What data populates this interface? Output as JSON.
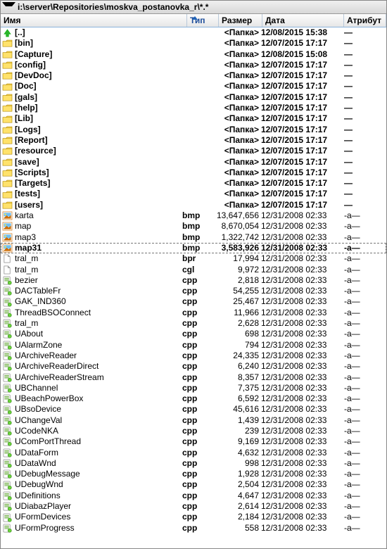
{
  "path": "i:\\server\\Repositories\\moskva_postanovka_r\\*.*",
  "columns": {
    "name": "Имя",
    "ext": "Тип",
    "size": "Размер",
    "date": "Дата",
    "attr": "Атрибут"
  },
  "sort_arrow_on": "ext",
  "rows": [
    {
      "type": "up",
      "name": "[..]",
      "ext": "",
      "size": "<Папка>",
      "date": "12/08/2015 15:38",
      "attr": "—",
      "folder": true
    },
    {
      "type": "folder",
      "name": "[bin]",
      "ext": "",
      "size": "<Папка>",
      "date": "12/07/2015 17:17",
      "attr": "—",
      "folder": true
    },
    {
      "type": "folder",
      "name": "[Capture]",
      "ext": "",
      "size": "<Папка>",
      "date": "12/08/2015 15:08",
      "attr": "—",
      "folder": true
    },
    {
      "type": "folder",
      "name": "[config]",
      "ext": "",
      "size": "<Папка>",
      "date": "12/07/2015 17:17",
      "attr": "—",
      "folder": true
    },
    {
      "type": "folder",
      "name": "[DevDoc]",
      "ext": "",
      "size": "<Папка>",
      "date": "12/07/2015 17:17",
      "attr": "—",
      "folder": true
    },
    {
      "type": "folder",
      "name": "[Doc]",
      "ext": "",
      "size": "<Папка>",
      "date": "12/07/2015 17:17",
      "attr": "—",
      "folder": true
    },
    {
      "type": "folder",
      "name": "[gals]",
      "ext": "",
      "size": "<Папка>",
      "date": "12/07/2015 17:17",
      "attr": "—",
      "folder": true
    },
    {
      "type": "folder",
      "name": "[help]",
      "ext": "",
      "size": "<Папка>",
      "date": "12/07/2015 17:17",
      "attr": "—",
      "folder": true
    },
    {
      "type": "folder",
      "name": "[Lib]",
      "ext": "",
      "size": "<Папка>",
      "date": "12/07/2015 17:17",
      "attr": "—",
      "folder": true
    },
    {
      "type": "folder",
      "name": "[Logs]",
      "ext": "",
      "size": "<Папка>",
      "date": "12/07/2015 17:17",
      "attr": "—",
      "folder": true
    },
    {
      "type": "folder",
      "name": "[Report]",
      "ext": "",
      "size": "<Папка>",
      "date": "12/07/2015 17:17",
      "attr": "—",
      "folder": true
    },
    {
      "type": "folder",
      "name": "[resource]",
      "ext": "",
      "size": "<Папка>",
      "date": "12/07/2015 17:17",
      "attr": "—",
      "folder": true
    },
    {
      "type": "folder",
      "name": "[save]",
      "ext": "",
      "size": "<Папка>",
      "date": "12/07/2015 17:17",
      "attr": "—",
      "folder": true
    },
    {
      "type": "folder",
      "name": "[Scripts]",
      "ext": "",
      "size": "<Папка>",
      "date": "12/07/2015 17:17",
      "attr": "—",
      "folder": true
    },
    {
      "type": "folder",
      "name": "[Targets]",
      "ext": "",
      "size": "<Папка>",
      "date": "12/07/2015 17:17",
      "attr": "—",
      "folder": true
    },
    {
      "type": "folder",
      "name": "[tests]",
      "ext": "",
      "size": "<Папка>",
      "date": "12/07/2015 17:17",
      "attr": "—",
      "folder": true
    },
    {
      "type": "folder",
      "name": "[users]",
      "ext": "",
      "size": "<Папка>",
      "date": "12/07/2015 17:17",
      "attr": "—",
      "folder": true
    },
    {
      "type": "bmp",
      "name": "karta",
      "ext": "bmp",
      "size": "13,647,656",
      "date": "12/31/2008 02:33",
      "attr": "-a—",
      "folder": false
    },
    {
      "type": "bmp",
      "name": "map",
      "ext": "bmp",
      "size": "8,670,054",
      "date": "12/31/2008 02:33",
      "attr": "-a—",
      "folder": false
    },
    {
      "type": "bmp",
      "name": "map3",
      "ext": "bmp",
      "size": "1,322,742",
      "date": "12/31/2008 02:33",
      "attr": "-a—",
      "folder": false
    },
    {
      "type": "bmp",
      "name": "map31",
      "ext": "bmp",
      "size": "3,583,926",
      "date": "12/31/2008 02:33",
      "attr": "-a—",
      "folder": false,
      "selected": true
    },
    {
      "type": "file",
      "name": "tral_m",
      "ext": "bpr",
      "size": "17,994",
      "date": "12/31/2008 02:33",
      "attr": "-a—",
      "folder": false
    },
    {
      "type": "file",
      "name": "tral_m",
      "ext": "cgl",
      "size": "9,972",
      "date": "12/31/2008 02:33",
      "attr": "-a—",
      "folder": false
    },
    {
      "type": "unit",
      "name": "bezier",
      "ext": "cpp",
      "size": "2,818",
      "date": "12/31/2008 02:33",
      "attr": "-a—",
      "folder": false
    },
    {
      "type": "unit",
      "name": "DACTableFr",
      "ext": "cpp",
      "size": "54,255",
      "date": "12/31/2008 02:33",
      "attr": "-a—",
      "folder": false
    },
    {
      "type": "unit",
      "name": "GAK_IND360",
      "ext": "cpp",
      "size": "25,467",
      "date": "12/31/2008 02:33",
      "attr": "-a—",
      "folder": false
    },
    {
      "type": "unit",
      "name": "ThreadBSOConnect",
      "ext": "cpp",
      "size": "11,966",
      "date": "12/31/2008 02:33",
      "attr": "-a—",
      "folder": false
    },
    {
      "type": "unit",
      "name": "tral_m",
      "ext": "cpp",
      "size": "2,628",
      "date": "12/31/2008 02:33",
      "attr": "-a—",
      "folder": false
    },
    {
      "type": "unit",
      "name": "UAbout",
      "ext": "cpp",
      "size": "698",
      "date": "12/31/2008 02:33",
      "attr": "-a—",
      "folder": false
    },
    {
      "type": "unit",
      "name": "UAlarmZone",
      "ext": "cpp",
      "size": "794",
      "date": "12/31/2008 02:33",
      "attr": "-a—",
      "folder": false
    },
    {
      "type": "unit",
      "name": "UArchiveReader",
      "ext": "cpp",
      "size": "24,335",
      "date": "12/31/2008 02:33",
      "attr": "-a—",
      "folder": false
    },
    {
      "type": "unit",
      "name": "UArchiveReaderDirect",
      "ext": "cpp",
      "size": "6,240",
      "date": "12/31/2008 02:33",
      "attr": "-a—",
      "folder": false
    },
    {
      "type": "unit",
      "name": "UArchiveReaderStream",
      "ext": "cpp",
      "size": "8,357",
      "date": "12/31/2008 02:33",
      "attr": "-a—",
      "folder": false
    },
    {
      "type": "unit",
      "name": "UBChannel",
      "ext": "cpp",
      "size": "7,375",
      "date": "12/31/2008 02:33",
      "attr": "-a—",
      "folder": false
    },
    {
      "type": "unit",
      "name": "UBeachPowerBox",
      "ext": "cpp",
      "size": "6,592",
      "date": "12/31/2008 02:33",
      "attr": "-a—",
      "folder": false
    },
    {
      "type": "unit",
      "name": "UBsoDevice",
      "ext": "cpp",
      "size": "45,616",
      "date": "12/31/2008 02:33",
      "attr": "-a—",
      "folder": false
    },
    {
      "type": "unit",
      "name": "UChangeVal",
      "ext": "cpp",
      "size": "1,439",
      "date": "12/31/2008 02:33",
      "attr": "-a—",
      "folder": false
    },
    {
      "type": "unit",
      "name": "UCodeNKA",
      "ext": "cpp",
      "size": "239",
      "date": "12/31/2008 02:33",
      "attr": "-a—",
      "folder": false
    },
    {
      "type": "unit",
      "name": "UComPortThread",
      "ext": "cpp",
      "size": "9,169",
      "date": "12/31/2008 02:33",
      "attr": "-a—",
      "folder": false
    },
    {
      "type": "unit",
      "name": "UDataForm",
      "ext": "cpp",
      "size": "4,632",
      "date": "12/31/2008 02:33",
      "attr": "-a—",
      "folder": false
    },
    {
      "type": "unit",
      "name": "UDataWnd",
      "ext": "cpp",
      "size": "998",
      "date": "12/31/2008 02:33",
      "attr": "-a—",
      "folder": false
    },
    {
      "type": "unit",
      "name": "UDebugMessage",
      "ext": "cpp",
      "size": "1,928",
      "date": "12/31/2008 02:33",
      "attr": "-a—",
      "folder": false
    },
    {
      "type": "unit",
      "name": "UDebugWnd",
      "ext": "cpp",
      "size": "2,504",
      "date": "12/31/2008 02:33",
      "attr": "-a—",
      "folder": false
    },
    {
      "type": "unit",
      "name": "UDefinitions",
      "ext": "cpp",
      "size": "4,647",
      "date": "12/31/2008 02:33",
      "attr": "-a—",
      "folder": false
    },
    {
      "type": "unit",
      "name": "UDiabazPlayer",
      "ext": "cpp",
      "size": "2,614",
      "date": "12/31/2008 02:33",
      "attr": "-a—",
      "folder": false
    },
    {
      "type": "unit",
      "name": "UFormDevices",
      "ext": "cpp",
      "size": "2,184",
      "date": "12/31/2008 02:33",
      "attr": "-a—",
      "folder": false
    },
    {
      "type": "unit",
      "name": "UFormProgress",
      "ext": "cpp",
      "size": "558",
      "date": "12/31/2008 02:33",
      "attr": "-a—",
      "folder": false
    }
  ]
}
